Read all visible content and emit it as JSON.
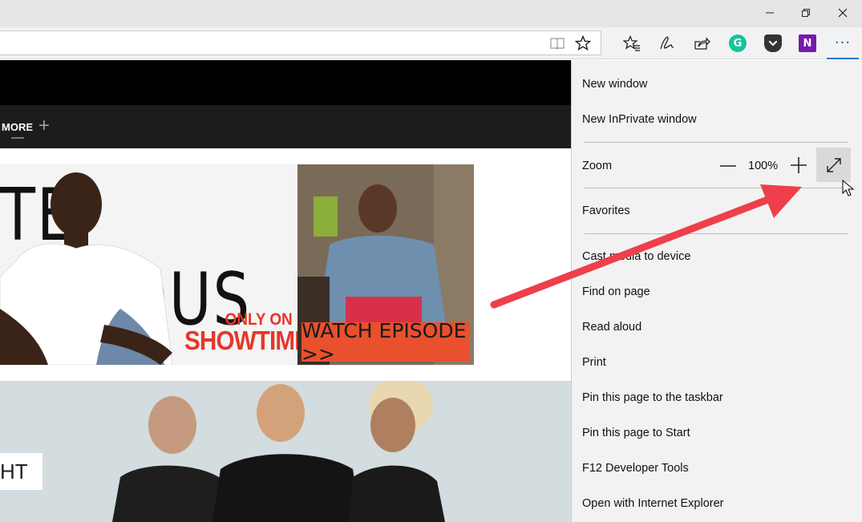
{
  "window": {
    "minimize_icon": "minimize-icon",
    "restore_icon": "restore-icon",
    "close_icon": "close-icon"
  },
  "toolbar": {
    "address_value": "",
    "reading_view_icon": "reading-view-icon",
    "favorite_star_icon": "star-icon",
    "favorites_hub_icon": "favorites-hub-icon",
    "web_note_icon": "web-note-pen-icon",
    "share_icon": "share-icon",
    "grammarly_label": "G",
    "pocket_icon": "pocket-icon",
    "onenote_label": "N",
    "more_label": "···"
  },
  "page": {
    "nav_more": "MORE",
    "nav_plus": "+",
    "ad": {
      "title": "TE FAMOUS",
      "only_on": "ONLY ON",
      "network": "SHOWTIME",
      "watch_label": "WATCH EPISODE >>"
    },
    "photo_label": "HT"
  },
  "menu": {
    "new_window": "New window",
    "new_inprivate": "New InPrivate window",
    "zoom_label": "Zoom",
    "zoom_value": "100%",
    "favorites": "Favorites",
    "cast": "Cast media to device",
    "find": "Find on page",
    "read_aloud": "Read aloud",
    "print": "Print",
    "pin_taskbar": "Pin this page to the taskbar",
    "pin_start": "Pin this page to Start",
    "f12": "F12 Developer Tools",
    "open_ie": "Open with Internet Explorer"
  },
  "colors": {
    "accent": "#0078d7",
    "annotation_arrow": "#ee3f4b",
    "grammarly": "#15c39a",
    "onenote": "#7719aa",
    "showtime_red": "#e5372a"
  }
}
